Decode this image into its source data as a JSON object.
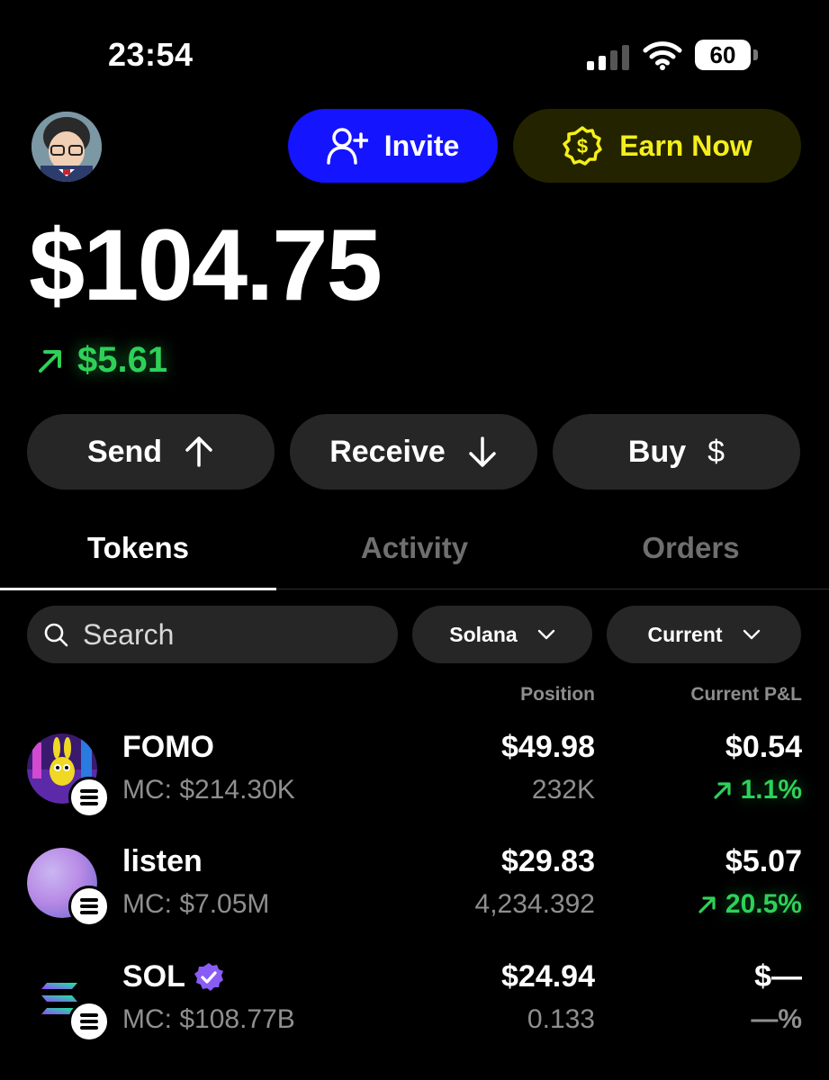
{
  "status_bar": {
    "time": "23:54",
    "battery": "60"
  },
  "header": {
    "invite_label": "Invite",
    "earn_label": "Earn Now",
    "colors": {
      "invite_bg": "#1414ff",
      "earn_bg": "#232300",
      "earn_text": "#f4ef1c"
    }
  },
  "balance": {
    "total": "$104.75",
    "change": "$5.61",
    "change_color": "#2ed158"
  },
  "actions": {
    "send": "Send",
    "receive": "Receive",
    "buy": "Buy",
    "buy_symbol": "$"
  },
  "tabs": [
    {
      "label": "Tokens",
      "active": true
    },
    {
      "label": "Activity",
      "active": false
    },
    {
      "label": "Orders",
      "active": false
    }
  ],
  "filters": {
    "search_placeholder": "Search",
    "network": "Solana",
    "sort": "Current"
  },
  "columns": {
    "position": "Position",
    "pnl": "Current P&L"
  },
  "tokens": [
    {
      "name": "FOMO",
      "mc": "MC: $214.30K",
      "position": "$49.98",
      "quantity": "232K",
      "pnl": "$0.54",
      "pnl_pct": "1.1%",
      "trend": "up",
      "verified": false
    },
    {
      "name": "listen",
      "mc": "MC: $7.05M",
      "position": "$29.83",
      "quantity": "4,234.392",
      "pnl": "$5.07",
      "pnl_pct": "20.5%",
      "trend": "up",
      "verified": false
    },
    {
      "name": "SOL",
      "mc": "MC: $108.77B",
      "position": "$24.94",
      "quantity": "0.133",
      "pnl": "$—",
      "pnl_pct": "—%",
      "trend": "none",
      "verified": true
    }
  ]
}
